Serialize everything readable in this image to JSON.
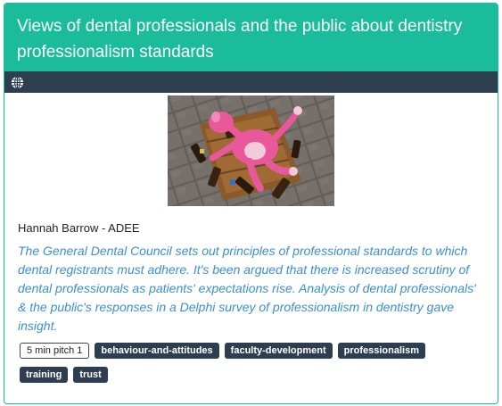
{
  "card": {
    "title": "Views of dental professionals and the public about dentistry professionalism standards",
    "author": "Hannah Barrow - ADEE",
    "summary": "The General Dental Council sets out principles of professional standards to which dental registrants must adhere. It's been argued that there is increased scrutiny of dental professionals as patients' expectations rise. Analysis of dental professionals' & the public's responses in a Delphi survey of professionalism in dentistry gave insight.",
    "toolbar_icon": "globe-icon",
    "image": {
      "subject": "pink-plush-toy-with-bottles-photo"
    },
    "format_tag": "5 min pitch 1",
    "tags": [
      "behaviour-and-attitudes",
      "faculty-development",
      "professionalism",
      "training",
      "trust"
    ]
  },
  "colors": {
    "header": "#1abc9c",
    "toolbar": "#2c3e50",
    "summary_text": "#3a8fd2",
    "tag_bg": "#2c3e50"
  }
}
